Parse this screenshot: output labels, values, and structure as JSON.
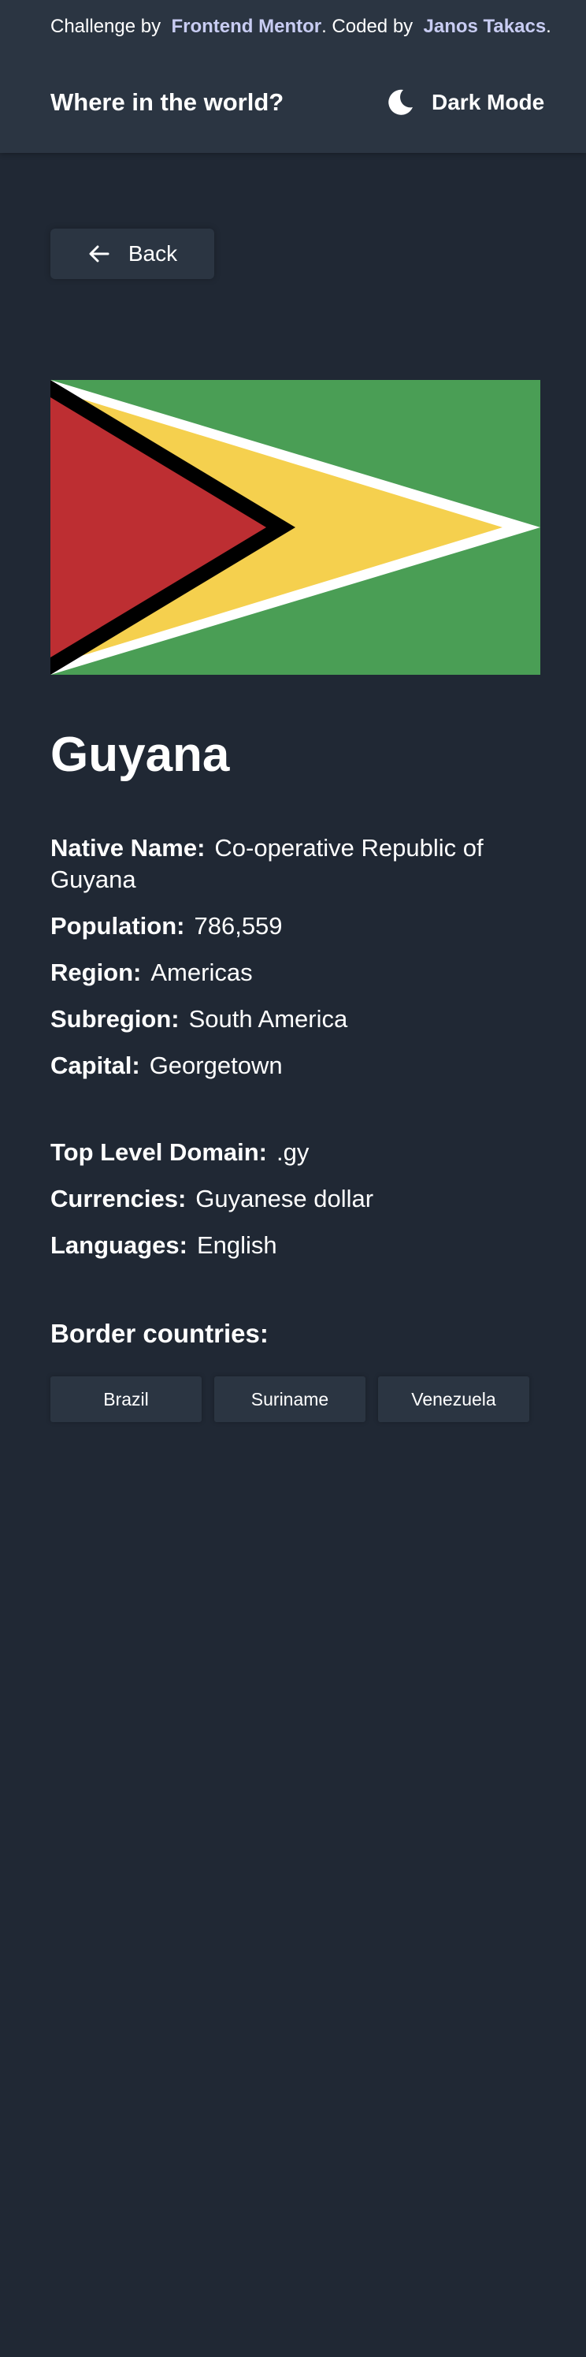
{
  "header": {
    "attribution_prefix": "Challenge by",
    "attribution_link1": "Frontend Mentor",
    "attribution_mid": ". Coded by",
    "attribution_link2": "Janos Takacs",
    "attribution_suffix": ".",
    "title": "Where in the world?",
    "theme_label": "Dark Mode",
    "theme_icon": "moon-icon"
  },
  "back_button": {
    "label": "Back",
    "icon": "arrow-left-icon"
  },
  "flag": {
    "colors": {
      "green": "#4a9e55",
      "white": "#ffffff",
      "yellow": "#f5d04e",
      "black": "#000000",
      "red": "#bd2e32"
    }
  },
  "country": {
    "name": "Guyana",
    "details_primary": [
      {
        "label": "Native Name:",
        "value": "Co-operative Republic of Guyana"
      },
      {
        "label": "Population:",
        "value": "786,559"
      },
      {
        "label": "Region:",
        "value": "Americas"
      },
      {
        "label": "Subregion:",
        "value": "South America"
      },
      {
        "label": "Capital:",
        "value": "Georgetown"
      }
    ],
    "details_secondary": [
      {
        "label": "Top Level Domain:",
        "value": ".gy"
      },
      {
        "label": "Currencies:",
        "value": "Guyanese dollar"
      },
      {
        "label": "Languages:",
        "value": "English"
      }
    ],
    "border_title": "Border countries:",
    "borders": [
      "Brazil",
      "Suriname",
      "Venezuela"
    ]
  },
  "colors": {
    "background": "#202834",
    "surface": "#2b3542",
    "link": "#c8ccf2",
    "text": "#ffffff"
  }
}
